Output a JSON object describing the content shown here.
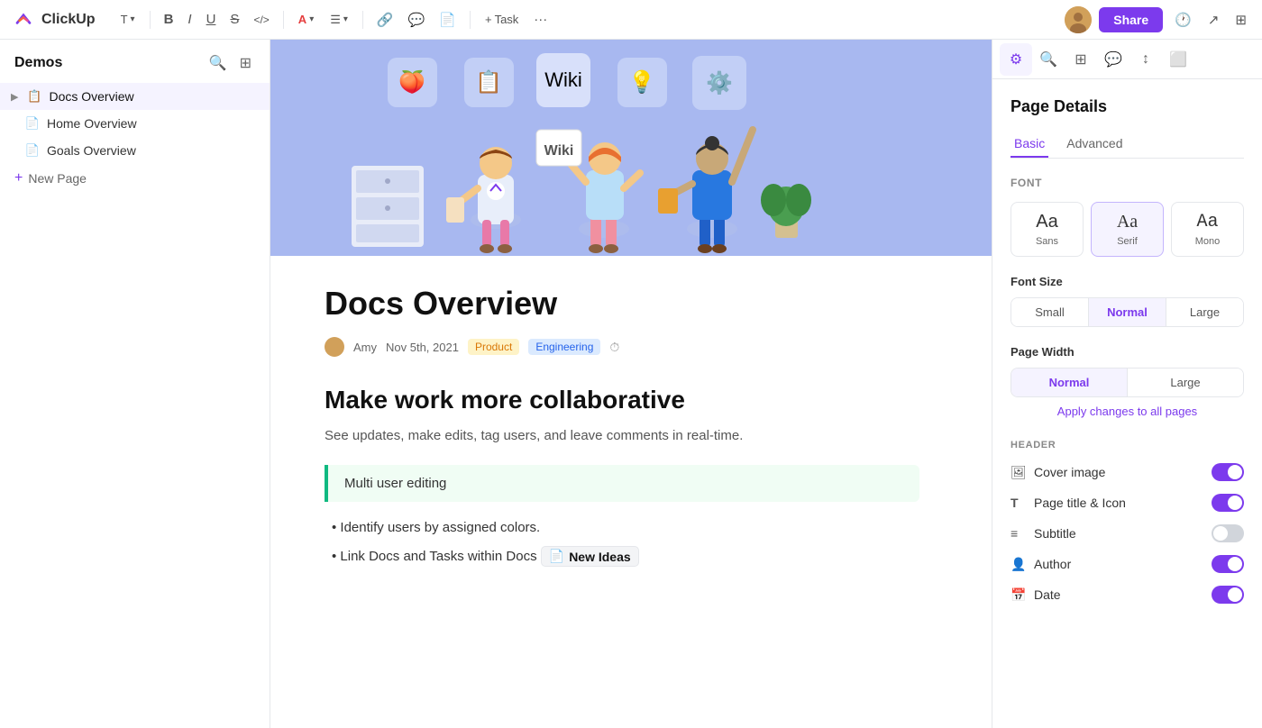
{
  "app": {
    "logo_text": "ClickUp",
    "share_label": "Share"
  },
  "toolbar": {
    "text_btn": "T",
    "bold": "B",
    "italic": "I",
    "underline": "U",
    "strikethrough": "S",
    "code": "</>",
    "font_color": "A",
    "align": "≡",
    "link": "🔗",
    "comment": "💬",
    "doc": "📄",
    "task": "+ Task",
    "more": "···"
  },
  "sidebar": {
    "title": "Demos",
    "items": [
      {
        "label": "Docs Overview",
        "type": "doc",
        "active": true,
        "has_arrow": true
      },
      {
        "label": "Home Overview",
        "type": "doc",
        "active": false,
        "has_arrow": false
      },
      {
        "label": "Goals Overview",
        "type": "doc",
        "active": false,
        "has_arrow": false
      }
    ],
    "new_page_label": "New Page"
  },
  "document": {
    "title": "Docs Overview",
    "author": "Amy",
    "date": "Nov 5th, 2021",
    "tags": [
      "Product",
      "Engineering"
    ],
    "heading": "Make work more collaborative",
    "description": "See updates, make edits, tag users, and leave comments in real-time.",
    "callout": "Multi user editing",
    "bullets": [
      "• Identify users by assigned colors.",
      "• Link Docs and Tasks within Docs"
    ],
    "inline_badge": "New Ideas"
  },
  "right_panel": {
    "section_title": "Page Details",
    "tabs": [
      {
        "label": "Basic",
        "active": true
      },
      {
        "label": "Advanced",
        "active": false
      }
    ],
    "font_label": "Font",
    "font_options": [
      {
        "label": "Sans",
        "aa": "Aa",
        "selected": false,
        "type": "sans"
      },
      {
        "label": "Serif",
        "aa": "Aa",
        "selected": true,
        "type": "serif"
      },
      {
        "label": "Mono",
        "aa": "Aa",
        "selected": false,
        "type": "mono"
      }
    ],
    "font_size_label": "Font Size",
    "size_options": [
      {
        "label": "Small",
        "selected": false
      },
      {
        "label": "Normal",
        "selected": true
      },
      {
        "label": "Large",
        "selected": false
      }
    ],
    "page_width_label": "Page Width",
    "width_options": [
      {
        "label": "Normal",
        "selected": true
      },
      {
        "label": "Large",
        "selected": false
      }
    ],
    "apply_label": "Apply changes to all pages",
    "header_label": "HEADER",
    "header_items": [
      {
        "label": "Cover image",
        "icon": "🖼",
        "on": true
      },
      {
        "label": "Page title & Icon",
        "icon": "T",
        "on": true
      },
      {
        "label": "Subtitle",
        "icon": "≡",
        "on": false
      },
      {
        "label": "Author",
        "icon": "👤",
        "on": true
      },
      {
        "label": "Date",
        "icon": "📅",
        "on": true
      }
    ]
  }
}
